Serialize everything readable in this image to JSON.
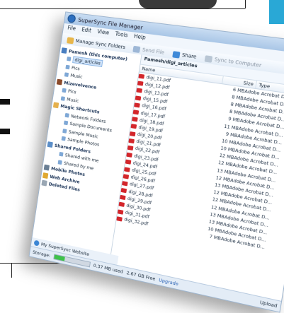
{
  "window": {
    "title": "SuperSync File Manager",
    "menu": [
      "File",
      "Edit",
      "View",
      "Tools",
      "Help"
    ]
  },
  "toolbar": {
    "manage_label": "Manage Sync Folders",
    "send_label": "Send File",
    "share_label": "Share",
    "sync_label": "Sync to Computer"
  },
  "tree": [
    {
      "label": "Pamesh (this computer)",
      "level": 0,
      "group": true,
      "icon": "computer-icon"
    },
    {
      "label": "digi_articles",
      "level": 1,
      "selected": true,
      "icon": "folder-icon"
    },
    {
      "label": "Pics",
      "level": 1,
      "icon": "folder-icon"
    },
    {
      "label": "Music",
      "level": 1,
      "icon": "folder-icon"
    },
    {
      "label": "Mizevolvence",
      "level": 0,
      "group": true,
      "icon": "user-icon"
    },
    {
      "label": "Pics",
      "level": 1,
      "icon": "folder-icon"
    },
    {
      "label": "Music",
      "level": 1,
      "icon": "folder-icon"
    },
    {
      "label": "Magic Shortcuts",
      "level": 0,
      "group": true,
      "icon": "folder-icon"
    },
    {
      "label": "Network Folders",
      "level": 2,
      "icon": "folder-icon"
    },
    {
      "label": "Sample Documents",
      "level": 2,
      "icon": "folder-icon"
    },
    {
      "label": "Sample Music",
      "level": 2,
      "icon": "folder-icon"
    },
    {
      "label": "Sample Photos",
      "level": 2,
      "icon": "folder-icon"
    },
    {
      "label": "Shared Folders",
      "level": 0,
      "group": true,
      "icon": "shared-icon"
    },
    {
      "label": "Shared with me",
      "level": 2,
      "icon": "folder-icon"
    },
    {
      "label": "Shared by me",
      "level": 2,
      "icon": "folder-icon"
    },
    {
      "label": "Mobile Photos",
      "level": 0,
      "group": true,
      "icon": "mobile-icon"
    },
    {
      "label": "Web Archive",
      "level": 0,
      "group": true,
      "icon": "web-icon"
    },
    {
      "label": "Deleted Files",
      "level": 0,
      "group": true,
      "icon": "files-icon"
    }
  ],
  "tree_footer": "My SuperSync Website",
  "path": "Pamesh/digi_articles",
  "columns": {
    "name": "Name",
    "size": "Size",
    "type": "Type"
  },
  "files": [
    {
      "name": "digi_11.pdf",
      "size": "6 MB",
      "type": "Adobe Acrobat D..."
    },
    {
      "name": "digi_12.pdf",
      "size": "8 MB",
      "type": "Adobe Acrobat D..."
    },
    {
      "name": "digi_13.pdf",
      "size": "8 MB",
      "type": "Adobe Acrobat D..."
    },
    {
      "name": "digi_15.pdf",
      "size": "8 MB",
      "type": "Adobe Acrobat D..."
    },
    {
      "name": "digi_16.pdf",
      "size": "9 MB",
      "type": "Adobe Acrobat D..."
    },
    {
      "name": "digi_17.pdf",
      "size": "11 MB",
      "type": "Adobe Acrobat D..."
    },
    {
      "name": "digi_18.pdf",
      "size": "9 MB",
      "type": "Adobe Acrobat D..."
    },
    {
      "name": "digi_19.pdf",
      "size": "10 MB",
      "type": "Adobe Acrobat D..."
    },
    {
      "name": "digi_20.pdf",
      "size": "10 MB",
      "type": "Adobe Acrobat D..."
    },
    {
      "name": "digi_21.pdf",
      "size": "12 MB",
      "type": "Adobe Acrobat D..."
    },
    {
      "name": "digi_22.pdf",
      "size": "12 MB",
      "type": "Adobe Acrobat D..."
    },
    {
      "name": "digi_23.pdf",
      "size": "13 MB",
      "type": "Adobe Acrobat D..."
    },
    {
      "name": "digi_24.pdf",
      "size": "12 MB",
      "type": "Adobe Acrobat D..."
    },
    {
      "name": "digi_25.pdf",
      "size": "13 MB",
      "type": "Adobe Acrobat D..."
    },
    {
      "name": "digi_26.pdf",
      "size": "12 MB",
      "type": "Adobe Acrobat D..."
    },
    {
      "name": "digi_27.pdf",
      "size": "12 MB",
      "type": "Adobe Acrobat D..."
    },
    {
      "name": "digi_28.pdf",
      "size": "12 MB",
      "type": "Adobe Acrobat D..."
    },
    {
      "name": "digi_29.pdf",
      "size": "13 MB",
      "type": "Adobe Acrobat D..."
    },
    {
      "name": "digi_30.pdf",
      "size": "13 MB",
      "type": "Adobe Acrobat D..."
    },
    {
      "name": "digi_31.pdf",
      "size": "10 MB",
      "type": "Adobe Acrobat D..."
    },
    {
      "name": "digi_32.pdf",
      "size": "7 MB",
      "type": "Adobe Acrobat D..."
    }
  ],
  "status": {
    "label": "Storage:",
    "used": "0.37 MB used",
    "free": "2.67 GB Free",
    "upgrade": "Upgrade",
    "storage_fraction": 0.3,
    "right": "Upload"
  },
  "colors": {
    "accent": "#3c86d4",
    "pdf": "#d3262b",
    "progress": "#3ec24a"
  }
}
